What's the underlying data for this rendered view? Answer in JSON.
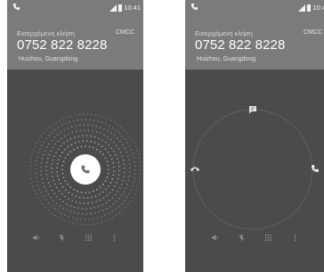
{
  "screens": [
    {
      "status_time": "10:41",
      "incoming_label": "Εισερχόμενη κλήση",
      "carrier": "CMCC",
      "number": "0752 822 8228",
      "location": "Huizhou, Guangdong"
    },
    {
      "status_time": "10:4",
      "incoming_label": "Εισερχόμενη κλήση",
      "carrier": "CMCC",
      "number": "0752 822 8228",
      "location": "Huizhou, Guangdong"
    }
  ],
  "colors": {
    "background": "#4a4b4d",
    "header": "#7a7b7d",
    "answer_button": "#ffffff",
    "dots": "#cfd0d2"
  },
  "icons": {
    "status": [
      "phone-icon",
      "signal-icon",
      "battery-icon"
    ],
    "left_center": "phone-icon",
    "right_targets": [
      "message-icon",
      "decline-call-icon",
      "answer-call-icon"
    ],
    "navbar": [
      "speaker-icon",
      "mute-icon",
      "dialpad-icon",
      "more-icon"
    ]
  }
}
